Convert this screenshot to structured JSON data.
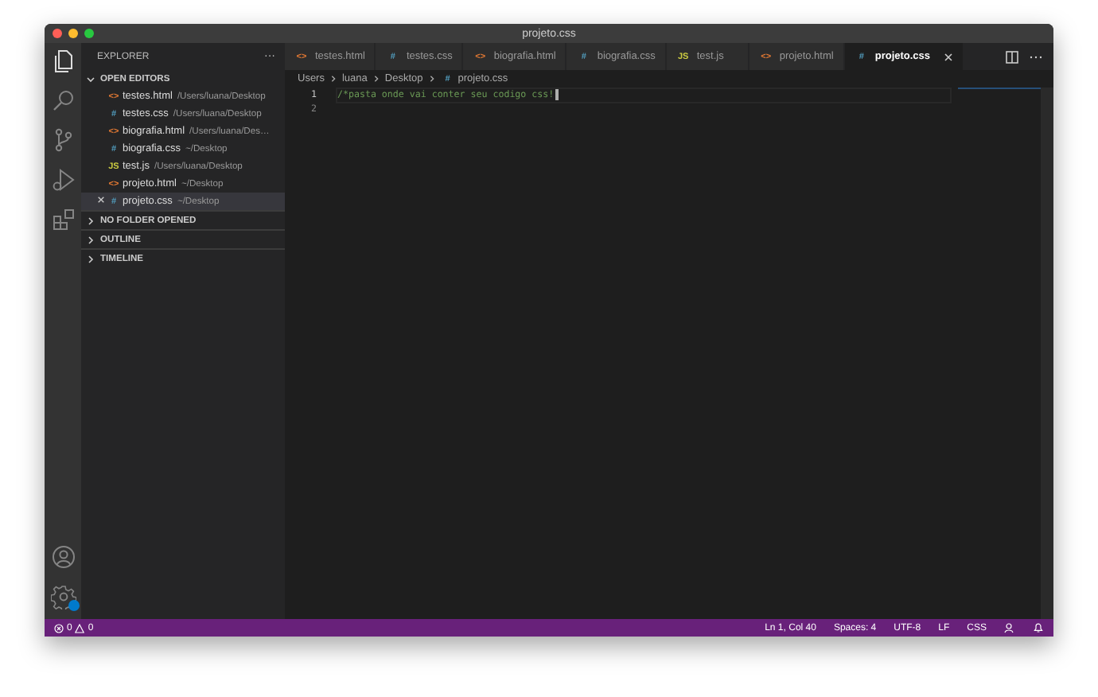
{
  "window": {
    "title": "projeto.css"
  },
  "sidebar": {
    "title": "EXPLORER",
    "more": "···",
    "open_editors": {
      "label": "OPEN EDITORS",
      "expanded": true,
      "items": [
        {
          "kind": "html",
          "icon": "<>",
          "name": "testes.html",
          "path": "/Users/luana/Desktop",
          "selected": false
        },
        {
          "kind": "css",
          "icon": "#",
          "name": "testes.css",
          "path": "/Users/luana/Desktop",
          "selected": false
        },
        {
          "kind": "html",
          "icon": "<>",
          "name": "biografia.html",
          "path": "/Users/luana/Des…",
          "selected": false
        },
        {
          "kind": "css",
          "icon": "#",
          "name": "biografia.css",
          "path": "~/Desktop",
          "selected": false
        },
        {
          "kind": "js",
          "icon": "JS",
          "name": "test.js",
          "path": "/Users/luana/Desktop",
          "selected": false
        },
        {
          "kind": "html",
          "icon": "<>",
          "name": "projeto.html",
          "path": "~/Desktop",
          "selected": false
        },
        {
          "kind": "css",
          "icon": "#",
          "name": "projeto.css",
          "path": "~/Desktop",
          "selected": true
        }
      ]
    },
    "sections": [
      {
        "label": "NO FOLDER OPENED",
        "expanded": false
      },
      {
        "label": "OUTLINE",
        "expanded": false
      },
      {
        "label": "TIMELINE",
        "expanded": false
      }
    ]
  },
  "tabs": [
    {
      "kind": "html",
      "icon": "<>",
      "label": "testes.html",
      "selected": false
    },
    {
      "kind": "css",
      "icon": "#",
      "label": "testes.css",
      "selected": false
    },
    {
      "kind": "html",
      "icon": "<>",
      "label": "biografia.html",
      "selected": false
    },
    {
      "kind": "css",
      "icon": "#",
      "label": "biografia.css",
      "selected": false
    },
    {
      "kind": "js",
      "icon": "JS",
      "label": "test.js",
      "selected": false
    },
    {
      "kind": "html",
      "icon": "<>",
      "label": "projeto.html",
      "selected": false
    },
    {
      "kind": "css",
      "icon": "#",
      "label": "projeto.css",
      "selected": true
    }
  ],
  "breadcrumbs": [
    {
      "label": "Users"
    },
    {
      "label": "luana"
    },
    {
      "label": "Desktop"
    },
    {
      "label": "projeto.css",
      "kind": "css",
      "icon": "#"
    }
  ],
  "editor": {
    "lines": [
      {
        "number": "1",
        "text": "/*pasta onde vai conter seu codigo css!",
        "current": true
      },
      {
        "number": "2",
        "current": false
      }
    ]
  },
  "status_bar": {
    "errors": "0",
    "warnings": "0",
    "items": [
      "Ln 1, Col 40",
      "Spaces: 4",
      "UTF-8",
      "LF",
      "CSS"
    ]
  }
}
